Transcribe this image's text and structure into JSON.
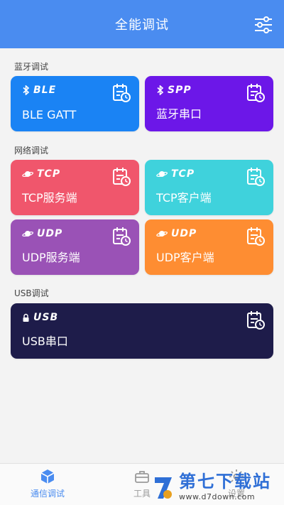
{
  "header": {
    "title": "全能调试",
    "settings_icon": "sliders-icon"
  },
  "sections": [
    {
      "label": "蓝牙调试"
    },
    {
      "label": "网络调试"
    },
    {
      "label": "USB调试"
    }
  ],
  "cards": [
    {
      "tag": "BLE",
      "label": "BLE GATT",
      "color": "#1a83f4",
      "tag_icon": "bluetooth-icon"
    },
    {
      "tag": "SPP",
      "label": "蓝牙串口",
      "color": "#6c17e8",
      "tag_icon": "bluetooth-icon"
    },
    {
      "tag": "TCP",
      "label": "TCP服务端",
      "color": "#f0566c",
      "tag_icon": "planet-icon"
    },
    {
      "tag": "TCP",
      "label": "TCP客户端",
      "color": "#3fd2dc",
      "tag_icon": "planet-icon"
    },
    {
      "tag": "UDP",
      "label": "UDP服务端",
      "color": "#9a52b6",
      "tag_icon": "planet-icon"
    },
    {
      "tag": "UDP",
      "label": "UDP客户端",
      "color": "#fe8d32",
      "tag_icon": "planet-icon"
    },
    {
      "tag": "USB",
      "label": "USB串口",
      "color": "#1e1c4a",
      "tag_icon": "lock-icon"
    }
  ],
  "bottom_nav": [
    {
      "label": "通信调试",
      "icon": "cube-icon",
      "active": true
    },
    {
      "label": "工具",
      "icon": "toolbox-icon",
      "active": false
    },
    {
      "label": "设置",
      "icon": "gear-icon",
      "active": false
    }
  ],
  "watermark": {
    "title": "第七下载站",
    "url": "www.d7down.com"
  }
}
